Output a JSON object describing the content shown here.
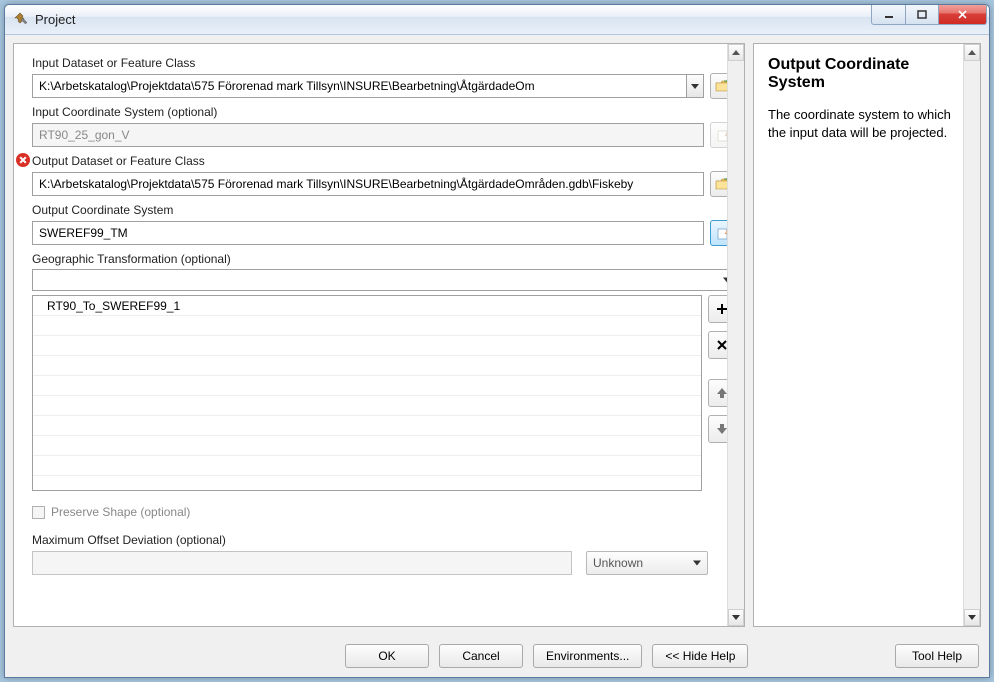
{
  "window": {
    "title": "Project"
  },
  "help": {
    "title": "Output Coordinate System",
    "body": "The coordinate system to which the input data will be projected."
  },
  "fields": {
    "input_dataset": {
      "label": "Input Dataset or Feature Class",
      "value": "K:\\Arbetskatalog\\Projektdata\\575 Förorenad mark Tillsyn\\INSURE\\Bearbetning\\ÅtgärdadeOm"
    },
    "input_cs": {
      "label": "Input Coordinate System (optional)",
      "value": "RT90_25_gon_V"
    },
    "output_dataset": {
      "label": "Output Dataset or Feature Class",
      "value": "K:\\Arbetskatalog\\Projektdata\\575 Förorenad mark Tillsyn\\INSURE\\Bearbetning\\ÅtgärdadeOmråden.gdb\\Fiskeby"
    },
    "output_cs": {
      "label": "Output Coordinate System",
      "value": "SWEREF99_TM"
    },
    "geo_transform": {
      "label": "Geographic Transformation (optional)",
      "items": [
        "RT90_To_SWEREF99_1"
      ]
    },
    "preserve_shape": {
      "label": "Preserve Shape (optional)"
    },
    "max_offset": {
      "label": "Maximum Offset Deviation (optional)",
      "unit": "Unknown"
    }
  },
  "buttons": {
    "ok": "OK",
    "cancel": "Cancel",
    "environments": "Environments...",
    "hide_help": "<< Hide Help",
    "tool_help": "Tool Help"
  }
}
